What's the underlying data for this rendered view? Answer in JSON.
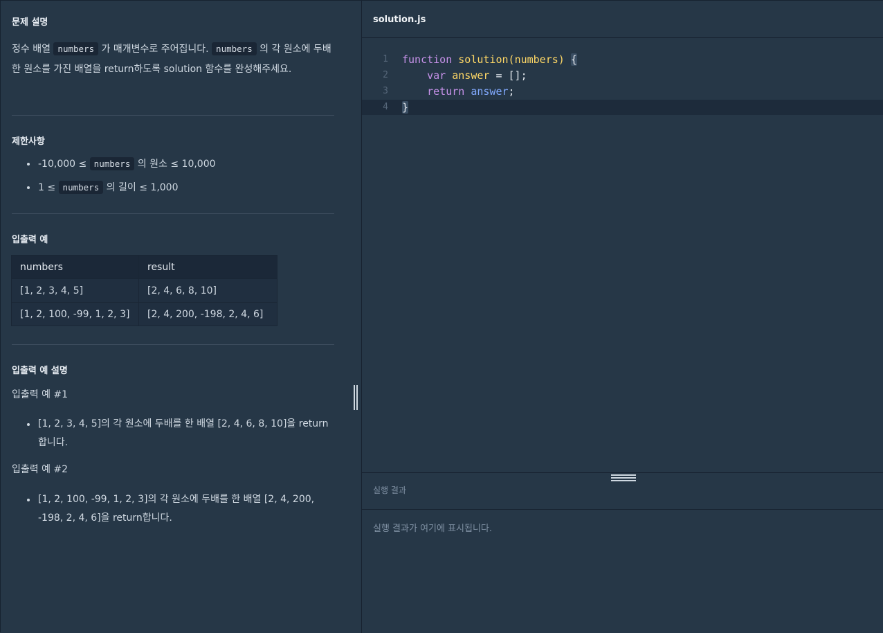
{
  "problem": {
    "title": "문제 설명",
    "desc_1": "정수 배열 ",
    "desc_code_1": "numbers",
    "desc_2": " 가 매개변수로 주어집니다. ",
    "desc_code_2": "numbers",
    "desc_3": " 의 각 원소에 두배한 원소를 가진 배열을 return하도록 solution 함수를 완성해주세요."
  },
  "constraints": {
    "title": "제한사항",
    "items": [
      {
        "pre": "-10,000 ≤ ",
        "code": "numbers",
        "post": " 의 원소 ≤ 10,000"
      },
      {
        "pre": "1 ≤ ",
        "code": "numbers",
        "post": " 의 길이 ≤ 1,000"
      }
    ]
  },
  "io_example": {
    "title": "입출력 예",
    "headers": [
      "numbers",
      "result"
    ],
    "rows": [
      [
        "[1, 2, 3, 4, 5]",
        "[2, 4, 6, 8, 10]"
      ],
      [
        "[1, 2, 100, -99, 1, 2, 3]",
        "[2, 4, 200, -198, 2, 4, 6]"
      ]
    ]
  },
  "io_explanation": {
    "title": "입출력 예 설명",
    "ex1_title": "입출력 예 #1",
    "ex1_text": "[1, 2, 3, 4, 5]의 각 원소에 두배를 한 배열 [2, 4, 6, 8, 10]을 return합니다.",
    "ex2_title": "입출력 예 #2",
    "ex2_text": "[1, 2, 100, -99, 1, 2, 3]의 각 원소에 두배를 한 배열 [2, 4, 200, -198, 2, 4, 6]을 return합니다."
  },
  "editor": {
    "filename": "solution.js",
    "line_numbers": [
      "1",
      "2",
      "3",
      "4"
    ],
    "line1": {
      "kw": "function",
      "fn": "solution",
      "open": "(",
      "param": "numbers",
      "close": ")",
      "brace": "{"
    },
    "line2": {
      "indent": "    ",
      "kw": "var",
      "var": "answer",
      "rest": " = [];"
    },
    "line3": {
      "indent": "    ",
      "kw": "return",
      "var": "answer",
      "rest": ";"
    },
    "line4": {
      "brace": "}"
    }
  },
  "result": {
    "title": "실행 결과",
    "placeholder": "실행 결과가 여기에 표시됩니다."
  }
}
